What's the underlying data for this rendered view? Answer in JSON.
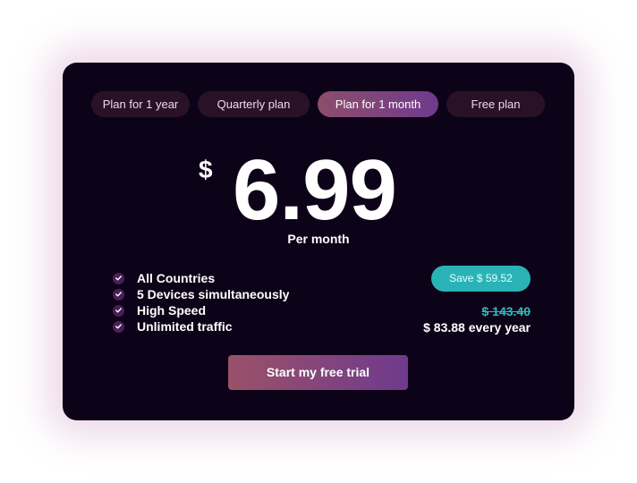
{
  "tabs": [
    {
      "label": "Plan for 1 year"
    },
    {
      "label": "Quarterly plan"
    },
    {
      "label": "Plan for 1 month",
      "active": true
    },
    {
      "label": "Free plan"
    }
  ],
  "price": {
    "currency": "$",
    "amount": "6.99",
    "period": "Per month"
  },
  "features": [
    {
      "label": "All Countries",
      "icon": "check-icon"
    },
    {
      "label": "5 Devices simultaneously",
      "icon": "check-icon"
    },
    {
      "label": "High Speed",
      "icon": "check-icon"
    },
    {
      "label": "Unlimited traffic",
      "icon": "check-icon"
    }
  ],
  "savings": {
    "badge": "Save $ 59.52",
    "old_price": "$ 143.40",
    "yearly_price": "$ 83.88 every year"
  },
  "cta": {
    "label": "Start my free trial"
  },
  "colors": {
    "card_bg": "#0d0318",
    "tab_bg": "#2a1226",
    "accent_gradient_start": "#8d4e6a",
    "accent_gradient_end": "#6f3a8e",
    "teal": "#2ab3b7"
  }
}
